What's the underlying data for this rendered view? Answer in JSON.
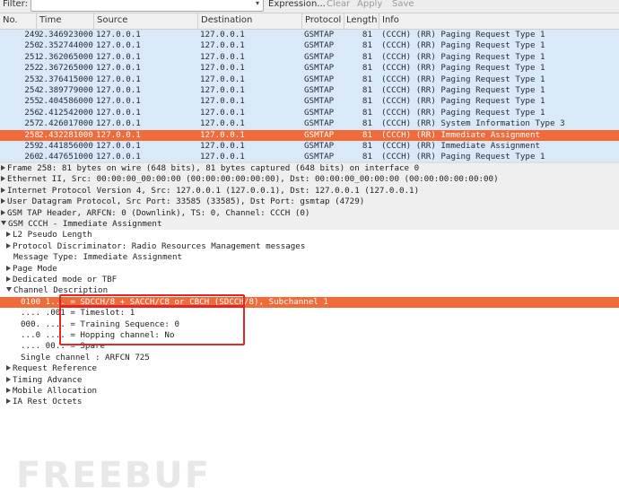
{
  "toolbar": {
    "filter_label": "Filter:",
    "filter_value": "",
    "dropdown_glyph": "▾",
    "expression": "Expression...",
    "clear": "Clear",
    "apply": "Apply",
    "save": "Save"
  },
  "columns": {
    "no": "No.",
    "time": "Time",
    "source": "Source",
    "destination": "Destination",
    "protocol": "Protocol",
    "length": "Length",
    "info": "Info"
  },
  "packets": [
    {
      "no": "249",
      "time": "2.346923000",
      "src": "127.0.0.1",
      "dst": "127.0.0.1",
      "proto": "GSMTAP",
      "len": "81",
      "info": "(CCCH) (RR) Paging Request Type 1"
    },
    {
      "no": "250",
      "time": "2.352744000",
      "src": "127.0.0.1",
      "dst": "127.0.0.1",
      "proto": "GSMTAP",
      "len": "81",
      "info": "(CCCH) (RR) Paging Request Type 1"
    },
    {
      "no": "251",
      "time": "2.362065000",
      "src": "127.0.0.1",
      "dst": "127.0.0.1",
      "proto": "GSMTAP",
      "len": "81",
      "info": "(CCCH) (RR) Paging Request Type 1"
    },
    {
      "no": "252",
      "time": "2.367265000",
      "src": "127.0.0.1",
      "dst": "127.0.0.1",
      "proto": "GSMTAP",
      "len": "81",
      "info": "(CCCH) (RR) Paging Request Type 1"
    },
    {
      "no": "253",
      "time": "2.376415000",
      "src": "127.0.0.1",
      "dst": "127.0.0.1",
      "proto": "GSMTAP",
      "len": "81",
      "info": "(CCCH) (RR) Paging Request Type 1"
    },
    {
      "no": "254",
      "time": "2.389779000",
      "src": "127.0.0.1",
      "dst": "127.0.0.1",
      "proto": "GSMTAP",
      "len": "81",
      "info": "(CCCH) (RR) Paging Request Type 1"
    },
    {
      "no": "255",
      "time": "2.404586000",
      "src": "127.0.0.1",
      "dst": "127.0.0.1",
      "proto": "GSMTAP",
      "len": "81",
      "info": "(CCCH) (RR) Paging Request Type 1"
    },
    {
      "no": "256",
      "time": "2.412542000",
      "src": "127.0.0.1",
      "dst": "127.0.0.1",
      "proto": "GSMTAP",
      "len": "81",
      "info": "(CCCH) (RR) Paging Request Type 1"
    },
    {
      "no": "257",
      "time": "2.426017000",
      "src": "127.0.0.1",
      "dst": "127.0.0.1",
      "proto": "GSMTAP",
      "len": "81",
      "info": "(CCCH) (RR) System Information Type 3"
    },
    {
      "no": "258",
      "time": "2.432281000",
      "src": "127.0.0.1",
      "dst": "127.0.0.1",
      "proto": "GSMTAP",
      "len": "81",
      "info": "(CCCH) (RR) Immediate Assignment",
      "selected": true
    },
    {
      "no": "259",
      "time": "2.441856000",
      "src": "127.0.0.1",
      "dst": "127.0.0.1",
      "proto": "GSMTAP",
      "len": "81",
      "info": "(CCCH) (RR) Immediate Assignment"
    },
    {
      "no": "260",
      "time": "2.447651000",
      "src": "127.0.0.1",
      "dst": "127.0.0.1",
      "proto": "GSMTAP",
      "len": "81",
      "info": "(CCCH) (RR) Paging Request Type 1"
    }
  ],
  "details": [
    {
      "indent": 0,
      "arrow": "right",
      "top": true,
      "text": "Frame 258: 81 bytes on wire (648 bits), 81 bytes captured (648 bits) on interface 0"
    },
    {
      "indent": 0,
      "arrow": "right",
      "top": true,
      "text": "Ethernet II, Src: 00:00:00_00:00:00 (00:00:00:00:00:00), Dst: 00:00:00_00:00:00 (00:00:00:00:00:00)"
    },
    {
      "indent": 0,
      "arrow": "right",
      "top": true,
      "text": "Internet Protocol Version 4, Src: 127.0.0.1 (127.0.0.1), Dst: 127.0.0.1 (127.0.0.1)"
    },
    {
      "indent": 0,
      "arrow": "right",
      "top": true,
      "text": "User Datagram Protocol, Src Port: 33585 (33585), Dst Port: gsmtap (4729)"
    },
    {
      "indent": 0,
      "arrow": "right",
      "top": true,
      "text": "GSM TAP Header, ARFCN: 0 (Downlink), TS: 0, Channel: CCCH (0)"
    },
    {
      "indent": 0,
      "arrow": "down",
      "top": true,
      "text": "GSM CCCH - Immediate Assignment"
    },
    {
      "indent": 1,
      "arrow": "right",
      "text": "L2 Pseudo Length"
    },
    {
      "indent": 1,
      "arrow": "right",
      "text": "Protocol Discriminator: Radio Resources Management messages"
    },
    {
      "indent": 1,
      "arrow": "none",
      "text": "Message Type: Immediate Assignment"
    },
    {
      "indent": 1,
      "arrow": "right",
      "text": "Page Mode"
    },
    {
      "indent": 1,
      "arrow": "right",
      "text": "Dedicated mode or TBF"
    },
    {
      "indent": 1,
      "arrow": "down",
      "text": "Channel Description"
    },
    {
      "indent": 2,
      "arrow": "none",
      "selected": true,
      "text": "0100 1... = SDCCH/8 + SACCH/C8 or CBCH (SDCCH/8), Subchannel 1"
    },
    {
      "indent": 2,
      "arrow": "none",
      "text": ".... .001 = Timeslot: 1"
    },
    {
      "indent": 2,
      "arrow": "none",
      "text": "000. .... = Training Sequence: 0"
    },
    {
      "indent": 2,
      "arrow": "none",
      "text": "...0 .... = Hopping channel: No"
    },
    {
      "indent": 2,
      "arrow": "none",
      "text": ".... 00.. = Spare"
    },
    {
      "indent": 2,
      "arrow": "none",
      "text": "Single channel : ARFCN 725"
    },
    {
      "indent": 1,
      "arrow": "right",
      "text": "Request Reference"
    },
    {
      "indent": 1,
      "arrow": "right",
      "text": "Timing Advance"
    },
    {
      "indent": 1,
      "arrow": "right",
      "text": "Mobile Allocation"
    },
    {
      "indent": 1,
      "arrow": "right",
      "text": "IA Rest Octets"
    }
  ],
  "watermark": "FREEBUF",
  "colors": {
    "row_bg": "#dae9f8",
    "selected_bg": "#f06a3a",
    "annotation": "#e52626"
  }
}
